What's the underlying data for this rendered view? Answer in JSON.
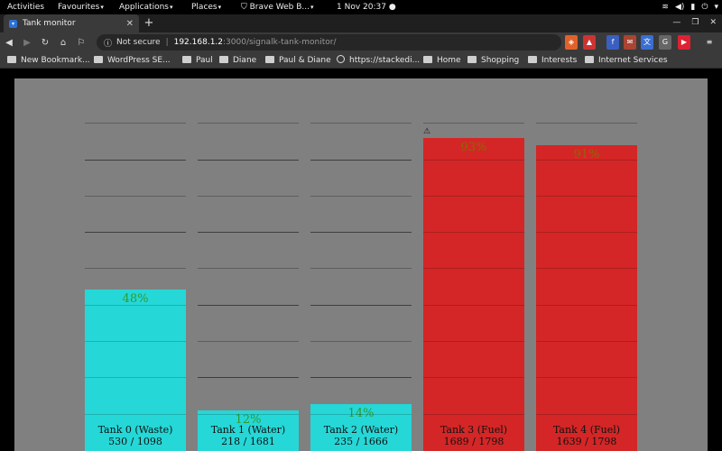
{
  "system_bar": {
    "activities": "Activities",
    "favourites": "Favourites",
    "applications": "Applications",
    "places": "Places",
    "active_app": "Brave Web B...",
    "clock": "1 Nov  20:37"
  },
  "browser": {
    "tab_title": "Tank monitor",
    "security_label": "Not secure",
    "url_host": "192.168.1.2",
    "url_path": ":3000/signalk-tank-monitor/",
    "bookmarks": [
      "New Bookmark...",
      "WordPress SE...",
      "Paul",
      "Diane",
      "Paul & Diane",
      "https://stackedi...",
      "Home",
      "Shopping",
      "Interests",
      "Internet Services"
    ]
  },
  "colors": {
    "panel": "#808080",
    "waste_water": "#26d7d7",
    "fuel": "#d42626",
    "percent_text": "#2f9a2f"
  },
  "tanks": [
    {
      "name": "Tank 0 (Waste)",
      "current": "530",
      "capacity": "1098",
      "reading": "530 / 1098",
      "percent": "48%",
      "level": 0.48,
      "kind": "waste"
    },
    {
      "name": "Tank 1 (Water)",
      "current": "218",
      "capacity": "1681",
      "reading": "218 / 1681",
      "percent": "12%",
      "level": 0.12,
      "kind": "water"
    },
    {
      "name": "Tank 2 (Water)",
      "current": "235",
      "capacity": "1666",
      "reading": "235 / 1666",
      "percent": "14%",
      "level": 0.14,
      "kind": "water"
    },
    {
      "name": "Tank 3 (Fuel)",
      "current": "1689",
      "capacity": "1798",
      "reading": "1689 / 1798",
      "percent": "93%",
      "level": 0.93,
      "kind": "fuel",
      "warning": true
    },
    {
      "name": "Tank 4 (Fuel)",
      "current": "1639",
      "capacity": "1798",
      "reading": "1639 / 1798",
      "percent": "91%",
      "level": 0.91,
      "kind": "fuel"
    }
  ]
}
